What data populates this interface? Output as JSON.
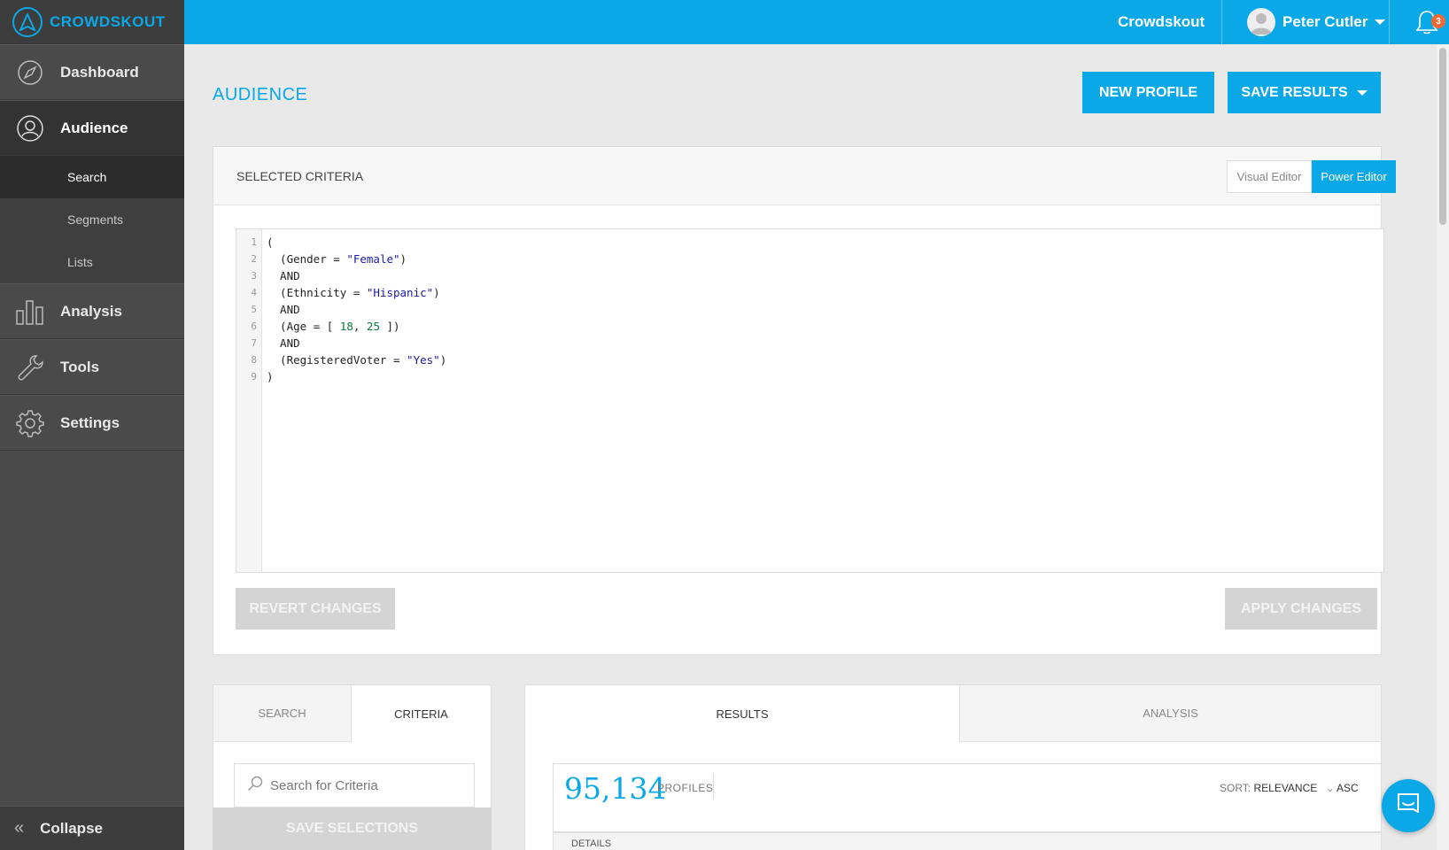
{
  "app": {
    "logo_text": "CROWDSKOUT"
  },
  "sidebar": {
    "items": [
      {
        "label": "Dashboard",
        "icon": "compass-icon"
      },
      {
        "label": "Audience",
        "icon": "users-icon"
      },
      {
        "label": "Analysis",
        "icon": "bar-chart-icon"
      },
      {
        "label": "Tools",
        "icon": "wrench-icon"
      },
      {
        "label": "Settings",
        "icon": "gear-icon"
      }
    ],
    "sub_items": [
      "Search",
      "Segments",
      "Lists"
    ],
    "collapse_label": "Collapse"
  },
  "topbar": {
    "brand": "Crowdskout",
    "user_name": "Peter Cutler",
    "notification_count": "3"
  },
  "page": {
    "title": "AUDIENCE",
    "new_profile": "NEW PROFILE",
    "save_results": "SAVE RESULTS"
  },
  "criteria": {
    "title": "SELECTED CRITERIA",
    "visual_editor": "Visual Editor",
    "power_editor": "Power Editor",
    "code_lines": [
      "(",
      "  (Gender = \"Female\")",
      "  AND",
      "  (Ethnicity = \"Hispanic\")",
      "  AND",
      "  (Age = [ 18, 25 ])",
      "  AND",
      "  (RegisteredVoter = \"Yes\")",
      ")"
    ],
    "revert": "REVERT CHANGES",
    "apply": "APPLY CHANGES"
  },
  "left_panel": {
    "tabs": [
      "SEARCH",
      "CRITERIA"
    ],
    "search_placeholder": "Search for Criteria",
    "save_selections": "SAVE SELECTIONS"
  },
  "right_panel": {
    "tabs": [
      "RESULTS",
      "ANALYSIS"
    ],
    "count": "95,134",
    "count_label": "PROFILES",
    "sort_label": "SORT:",
    "sort_value": "RELEVANCE",
    "order": "ASC",
    "details": "DETAILS"
  },
  "colors": {
    "accent": "#0aa8e6",
    "sidebar": "#4a4a4a",
    "badge": "#f06a35"
  }
}
